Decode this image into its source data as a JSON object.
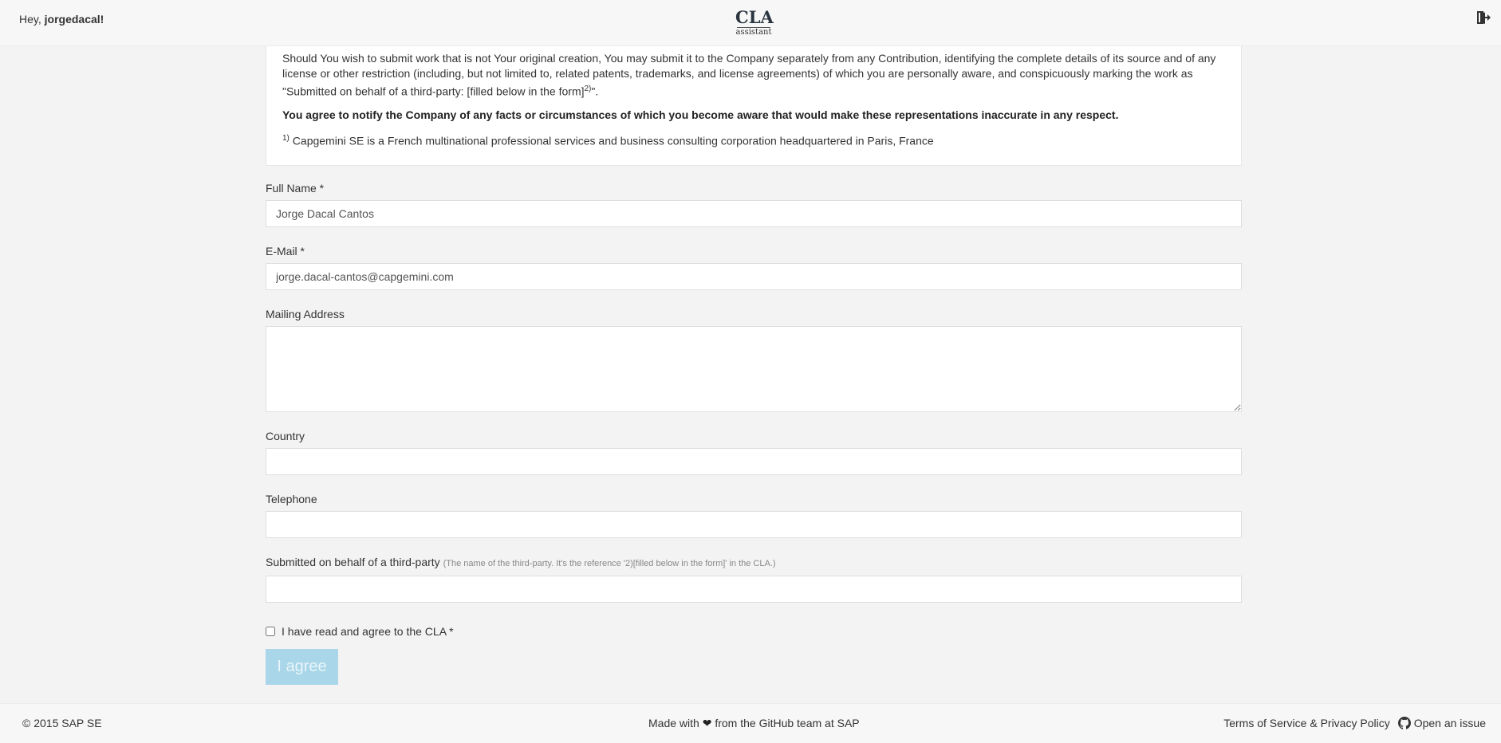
{
  "header": {
    "greeting_prefix": "Hey, ",
    "username": "jorgedacal",
    "greeting_suffix": "!",
    "logo_main": "CLA",
    "logo_sub": "assistant"
  },
  "cla": {
    "para1_a": "Should You wish to submit work that is not Your original creation, You may submit it to the Company separately from any Contribution, identifying the complete details of its source and of any license or other restriction (including, but not limited to, related patents, trademarks, and license agreements) of which you are personally aware, and conspicuously marking the work as \"Submitted on behalf of a third-party: [filled below in the form]",
    "para1_sup": "2)",
    "para1_b": "\".",
    "para2": "You agree to notify the Company of any facts or circumstances of which you become aware that would make these representations inaccurate in any respect.",
    "footnote_sup": "1)",
    "footnote": " Capgemini SE is a French multinational professional services and business consulting corporation headquartered in Paris, France"
  },
  "form": {
    "full_name_label": "Full Name *",
    "full_name_value": "Jorge Dacal Cantos",
    "email_label": "E-Mail *",
    "email_value": "jorge.dacal-cantos@capgemini.com",
    "address_label": "Mailing Address",
    "address_value": "",
    "country_label": "Country",
    "country_value": "",
    "telephone_label": "Telephone",
    "telephone_value": "",
    "third_party_label": "Submitted on behalf of a third-party",
    "third_party_hint": "(The name of the third-party. It's the reference '2)[filled below in the form]' in the CLA.)",
    "third_party_value": "",
    "agree_checkbox_label": "I have read and agree to the CLA *",
    "agree_button": "I agree"
  },
  "footer": {
    "copyright": "© 2015 SAP SE",
    "made_prefix": "Made with ",
    "made_suffix": " from the GitHub team at SAP",
    "terms_link": "Terms of Service & Privacy Policy",
    "issue_link": "Open an issue"
  },
  "colors": {
    "button_disabled_bg": "#a9d6e8",
    "page_bg": "#f3f3f3"
  },
  "icons": {
    "logout": "sign-out-icon",
    "heart": "heart-icon",
    "github": "github-icon"
  }
}
